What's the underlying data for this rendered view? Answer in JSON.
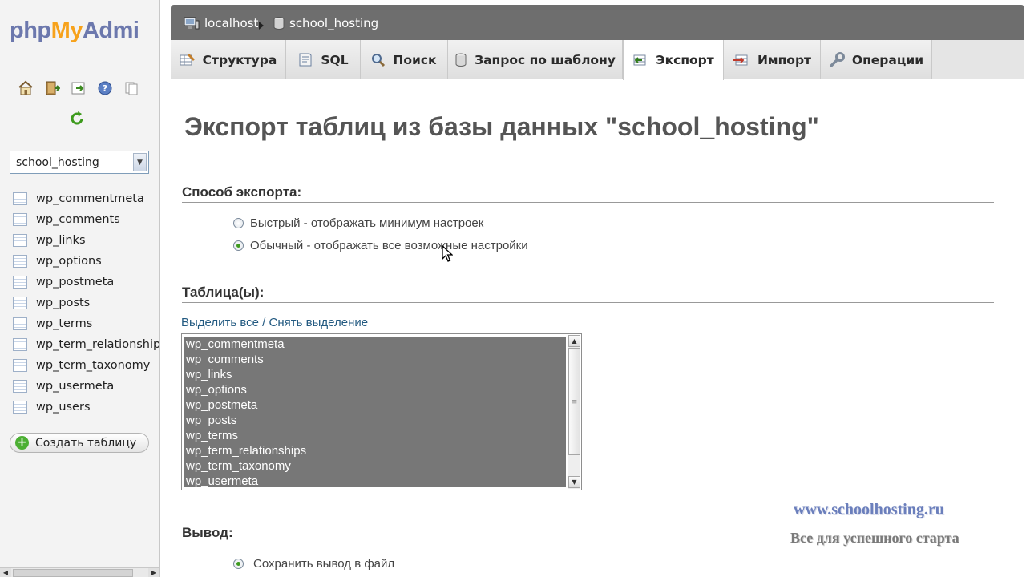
{
  "sidebar": {
    "logo_main": "phpMyAdmi",
    "logo_prefix": "php",
    "logo_accent": "My",
    "logo_suffix": "Admi",
    "db_select_value": "school_hosting",
    "tables": [
      "wp_commentmeta",
      "wp_comments",
      "wp_links",
      "wp_options",
      "wp_postmeta",
      "wp_posts",
      "wp_terms",
      "wp_term_relationships",
      "wp_term_taxonomy",
      "wp_usermeta",
      "wp_users"
    ],
    "create_table_label": "Создать таблицу",
    "tool_icons": [
      "home-icon",
      "exit-icon",
      "query-window-icon",
      "help-icon",
      "docs-icon"
    ]
  },
  "breadcrumb": {
    "server": "localhost",
    "database": "school_hosting"
  },
  "tabs": [
    {
      "label": "Структура",
      "icon": "structure-icon"
    },
    {
      "label": "SQL",
      "icon": "sql-icon"
    },
    {
      "label": "Поиск",
      "icon": "search-icon"
    },
    {
      "label": "Запрос по шаблону",
      "icon": "query-icon"
    },
    {
      "label": "Экспорт",
      "icon": "export-icon",
      "active": true
    },
    {
      "label": "Импорт",
      "icon": "import-icon"
    },
    {
      "label": "Операции",
      "icon": "operations-icon"
    }
  ],
  "main": {
    "title": "Экспорт таблиц из базы данных \"school_hosting\"",
    "export_method": {
      "heading": "Способ экспорта:",
      "options": [
        {
          "label": "Быстрый - отображать минимум настроек",
          "checked": false
        },
        {
          "label": "Обычный - отображать все возможные настройки",
          "checked": true
        }
      ]
    },
    "tables_section": {
      "heading": "Таблица(ы):",
      "select_all": "Выделить все",
      "separator": " / ",
      "unselect_all": "Снять выделение",
      "listbox_items": [
        "wp_commentmeta",
        "wp_comments",
        "wp_links",
        "wp_options",
        "wp_postmeta",
        "wp_posts",
        "wp_terms",
        "wp_term_relationships",
        "wp_term_taxonomy",
        "wp_usermeta"
      ]
    },
    "output": {
      "heading": "Вывод:",
      "save_to_file": "Сохранить вывод в файл"
    }
  },
  "watermark": {
    "url": "www.schoolhosting.ru",
    "slogan": "Все для успешного старта"
  },
  "colors": {
    "topbar": "#6e6e6e",
    "link": "#235a81",
    "selected_list_bg": "#777777",
    "logo_blue": "#6c78ad",
    "logo_orange": "#f7a21b"
  }
}
